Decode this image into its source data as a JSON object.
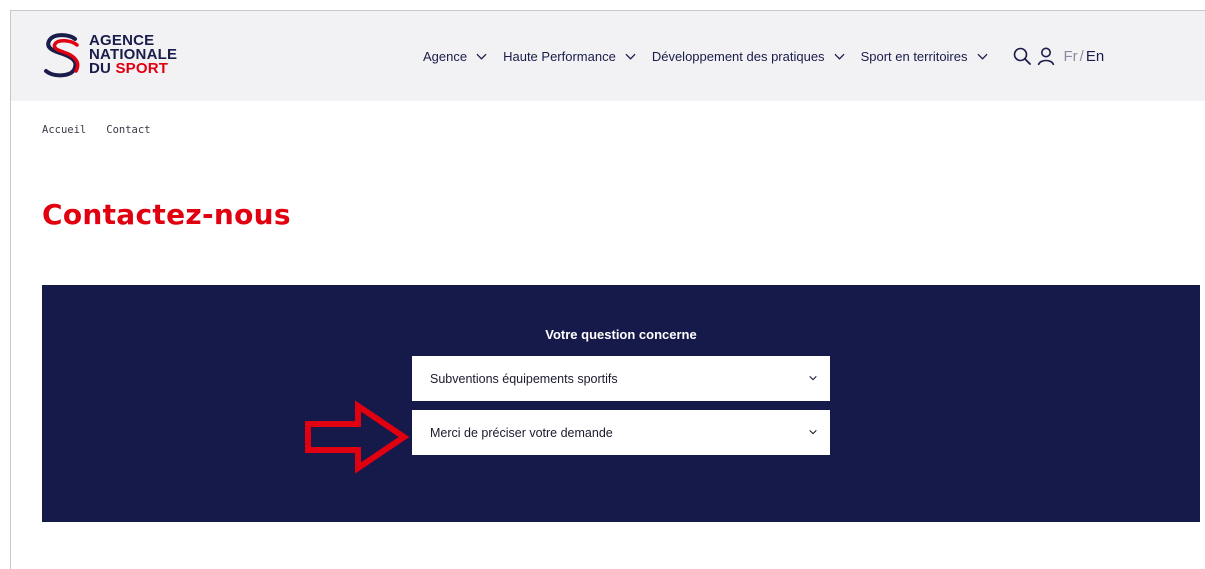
{
  "header": {
    "logo_lines": [
      "AGENCE",
      "NATIONALE",
      "DU",
      "SPORT"
    ],
    "nav": [
      {
        "label": "Agence"
      },
      {
        "label": "Haute Performance"
      },
      {
        "label": "Développement des pratiques"
      },
      {
        "label": "Sport en territoires"
      }
    ],
    "lang": {
      "fr": "Fr",
      "separator": "/",
      "en": "En"
    }
  },
  "breadcrumb": [
    "Accueil",
    "Contact"
  ],
  "page_title": "Contactez-nous",
  "form": {
    "question_label": "Votre question concerne",
    "select_topic_value": "Subventions équipements sportifs",
    "select_request_value": "Merci de préciser votre demande"
  },
  "colors": {
    "brand_red": "#e1000f",
    "brand_navy": "#161a4a",
    "header_bg": "#f2f2f4"
  },
  "icons": [
    "chevron-down-icon",
    "search-icon",
    "user-icon",
    "right-arrow-annotation"
  ]
}
